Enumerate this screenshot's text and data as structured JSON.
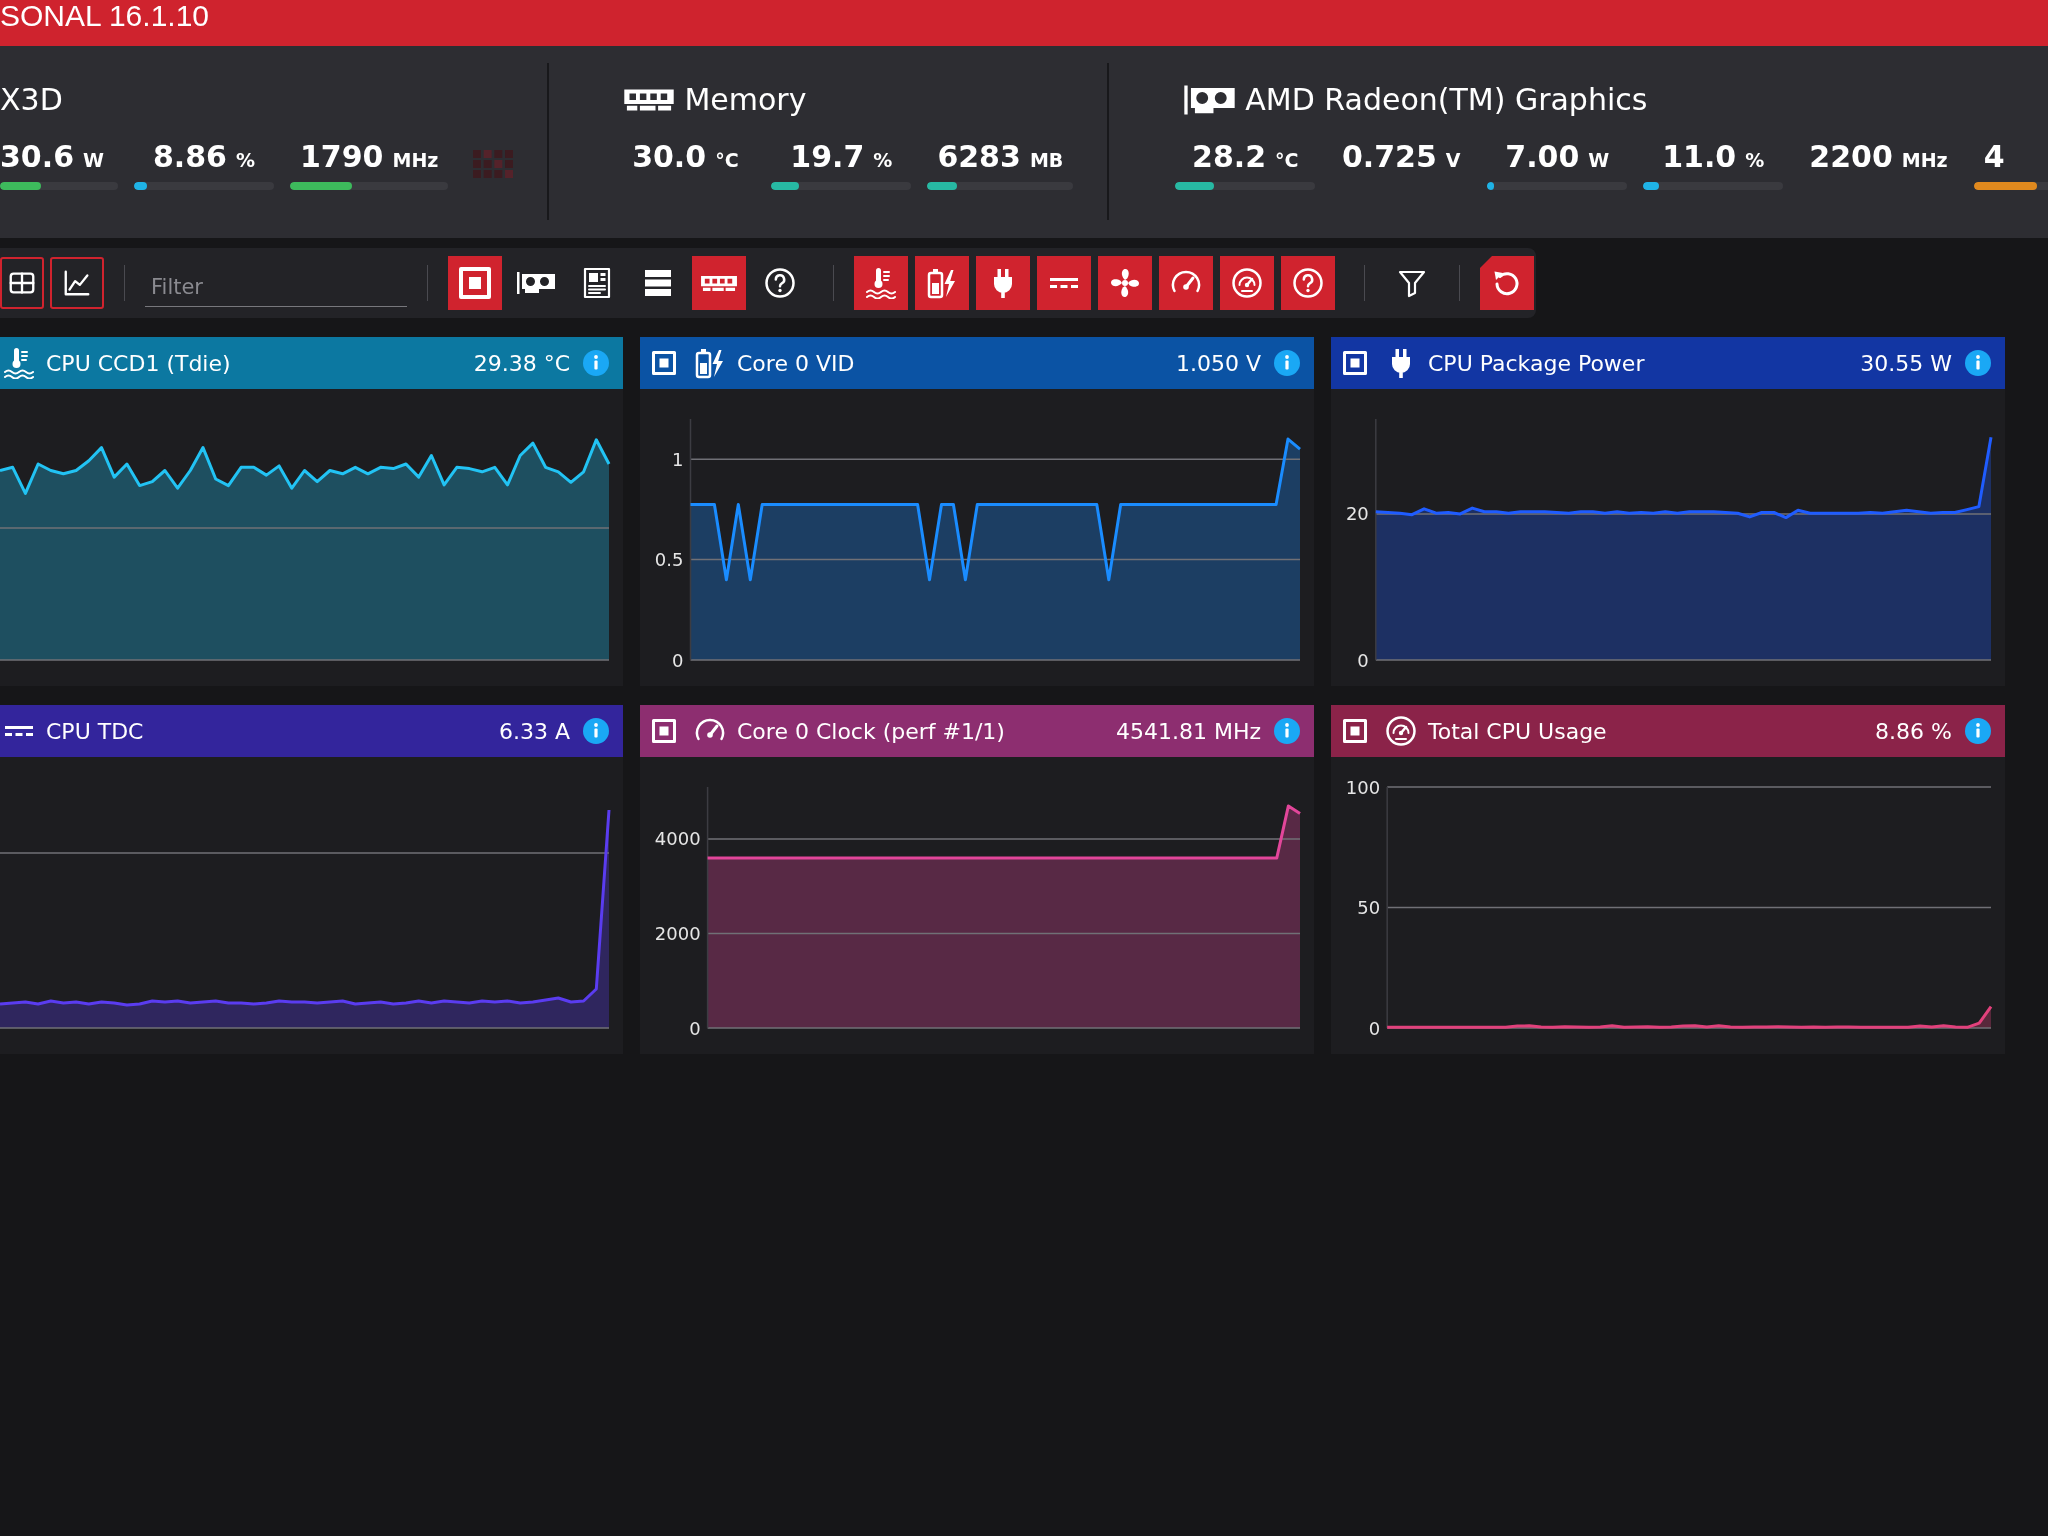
{
  "title_bar": {
    "title": "SONAL 16.1.10"
  },
  "devices": [
    {
      "kind": "cpu",
      "name": "X3D",
      "readings": [
        {
          "value": "30.6",
          "unit": "W",
          "level": 0.35,
          "color": "#3dba5c"
        },
        {
          "value": "8.86",
          "unit": "%",
          "level": 0.09,
          "color": "#1fb3e6"
        },
        {
          "value": "1790",
          "unit": "MHz",
          "level": 0.39,
          "color": "#3dba5c"
        }
      ]
    },
    {
      "kind": "memory",
      "name": "Memory",
      "readings": [
        {
          "value": "30.0",
          "unit": "°C"
        },
        {
          "value": "19.7",
          "unit": "%",
          "level": 0.2,
          "color": "#27b9a3"
        },
        {
          "value": "6283",
          "unit": "MB",
          "level": 0.2,
          "color": "#27b9a3"
        }
      ]
    },
    {
      "kind": "gpu",
      "name": "AMD Radeon(TM) Graphics",
      "readings": [
        {
          "value": "28.2",
          "unit": "°C",
          "level": 0.28,
          "color": "#27b9a3"
        },
        {
          "value": "0.725",
          "unit": "V"
        },
        {
          "value": "7.00",
          "unit": "W",
          "level": 0.05,
          "color": "#1fb3e6"
        },
        {
          "value": "11.0",
          "unit": "%",
          "level": 0.11,
          "color": "#1fb3e6"
        },
        {
          "value": "2200",
          "unit": "MHz"
        },
        {
          "value": "4",
          "level": 0.45,
          "color": "#e0891e"
        }
      ]
    }
  ],
  "toolbar": {
    "view_buttons": [
      {
        "kind": "table"
      },
      {
        "kind": "chart"
      }
    ],
    "filter": {
      "placeholder": "Filter"
    },
    "device_filters": [
      {
        "kind": "cpu",
        "selected": true
      },
      {
        "kind": "gpu",
        "selected": false
      },
      {
        "kind": "motherboard",
        "selected": false
      },
      {
        "kind": "storage",
        "selected": false
      },
      {
        "kind": "memory",
        "selected": true
      },
      {
        "kind": "other",
        "selected": false
      }
    ],
    "sensor_filters": [
      {
        "kind": "temperature",
        "selected": true
      },
      {
        "kind": "voltage",
        "selected": true
      },
      {
        "kind": "power",
        "selected": true
      },
      {
        "kind": "current",
        "selected": true
      },
      {
        "kind": "fan",
        "selected": true
      },
      {
        "kind": "clock",
        "selected": true
      },
      {
        "kind": "usage",
        "selected": true
      },
      {
        "kind": "other",
        "selected": true
      }
    ],
    "filter_button": {
      "selected": false
    }
  },
  "panels": [
    {
      "kind": "temperature",
      "title": "CPU CCD1 (Tdie)",
      "value": "29.38 °C",
      "color": "#0c78a1"
    },
    {
      "kind": "voltage",
      "title": "Core 0 VID",
      "value": "1.050 V",
      "color": "#0b53a4",
      "chart_data": {
        "type": "area",
        "color": "#1a8cff",
        "yticks": [
          0,
          0.5,
          1
        ],
        "ylim": [
          0,
          1.2
        ],
        "grid": true,
        "values": [
          0.775,
          0.775,
          0.775,
          0.4,
          0.775,
          0.4,
          0.775,
          0.775,
          0.775,
          0.775,
          0.775,
          0.775,
          0.775,
          0.775,
          0.775,
          0.775,
          0.775,
          0.775,
          0.775,
          0.775,
          0.4,
          0.775,
          0.775,
          0.4,
          0.775,
          0.775,
          0.775,
          0.775,
          0.775,
          0.775,
          0.775,
          0.775,
          0.775,
          0.775,
          0.775,
          0.4,
          0.775,
          0.775,
          0.775,
          0.775,
          0.775,
          0.775,
          0.775,
          0.775,
          0.775,
          0.775,
          0.775,
          0.775,
          0.775,
          0.775,
          1.1,
          1.05
        ]
      }
    },
    {
      "kind": "power",
      "title": "CPU Package Power",
      "value": "30.55 W",
      "color": "#1236a3",
      "chart_data": {
        "type": "area",
        "color": "#1f5cff",
        "yticks": [
          0,
          20
        ],
        "ylim": [
          0,
          33
        ],
        "grid": true,
        "values": [
          20.3,
          20.2,
          20.1,
          19.9,
          20.7,
          20.1,
          20.2,
          20.0,
          20.8,
          20.3,
          20.3,
          20.1,
          20.3,
          20.3,
          20.3,
          20.2,
          20.1,
          20.3,
          20.3,
          20.1,
          20.3,
          20.1,
          20.2,
          20.1,
          20.3,
          20.1,
          20.3,
          20.3,
          20.3,
          20.2,
          20.1,
          19.6,
          20.2,
          20.2,
          19.5,
          20.5,
          20.1,
          20.1,
          20.1,
          20.1,
          20.1,
          20.2,
          20.1,
          20.3,
          20.5,
          20.3,
          20.1,
          20.2,
          20.2,
          20.6,
          21.0,
          30.5
        ]
      }
    },
    {
      "kind": "current",
      "title": "CPU TDC",
      "value": "6.33 A",
      "color": "#33259c"
    },
    {
      "kind": "clock",
      "title": "Core 0 Clock (perf #1/1)",
      "value": "4541.81 MHz",
      "color": "#8d2e70",
      "chart_data": {
        "type": "area",
        "color": "#e2469a",
        "yticks": [
          0,
          2000,
          4000
        ],
        "ylim": [
          0,
          5100
        ],
        "grid": true,
        "values": [
          3600,
          3600,
          3600,
          3600,
          3600,
          3600,
          3600,
          3600,
          3600,
          3600,
          3600,
          3600,
          3600,
          3600,
          3600,
          3600,
          3600,
          3600,
          3600,
          3600,
          3600,
          3600,
          3600,
          3600,
          3600,
          3600,
          3600,
          3600,
          3600,
          3600,
          3600,
          3600,
          3600,
          3600,
          3600,
          3600,
          3600,
          3600,
          3600,
          3600,
          3600,
          3600,
          3600,
          3600,
          3600,
          3600,
          3600,
          3600,
          3600,
          3600,
          4700,
          4540
        ]
      }
    },
    {
      "kind": "usage",
      "title": "Total CPU Usage",
      "value": "8.86 %",
      "color": "#8b2349",
      "chart_data": {
        "type": "area",
        "color": "#e2417c",
        "yticks": [
          0,
          50,
          100
        ],
        "ylim": [
          0,
          100
        ],
        "grid": true,
        "values": [
          0.3,
          0.3,
          0.3,
          0.3,
          0.3,
          0.3,
          0.3,
          0.3,
          0.3,
          0.3,
          0.3,
          0.8,
          0.9,
          0.4,
          0.3,
          0.5,
          0.4,
          0.3,
          0.4,
          0.9,
          0.3,
          0.4,
          0.5,
          0.3,
          0.4,
          0.8,
          0.9,
          0.4,
          0.9,
          0.4,
          0.3,
          0.4,
          0.4,
          0.5,
          0.4,
          0.3,
          0.4,
          0.3,
          0.4,
          0.4,
          0.3,
          0.3,
          0.3,
          0.3,
          0.3,
          0.8,
          0.4,
          0.9,
          0.4,
          0.3,
          2.0,
          8.9
        ]
      }
    }
  ]
}
